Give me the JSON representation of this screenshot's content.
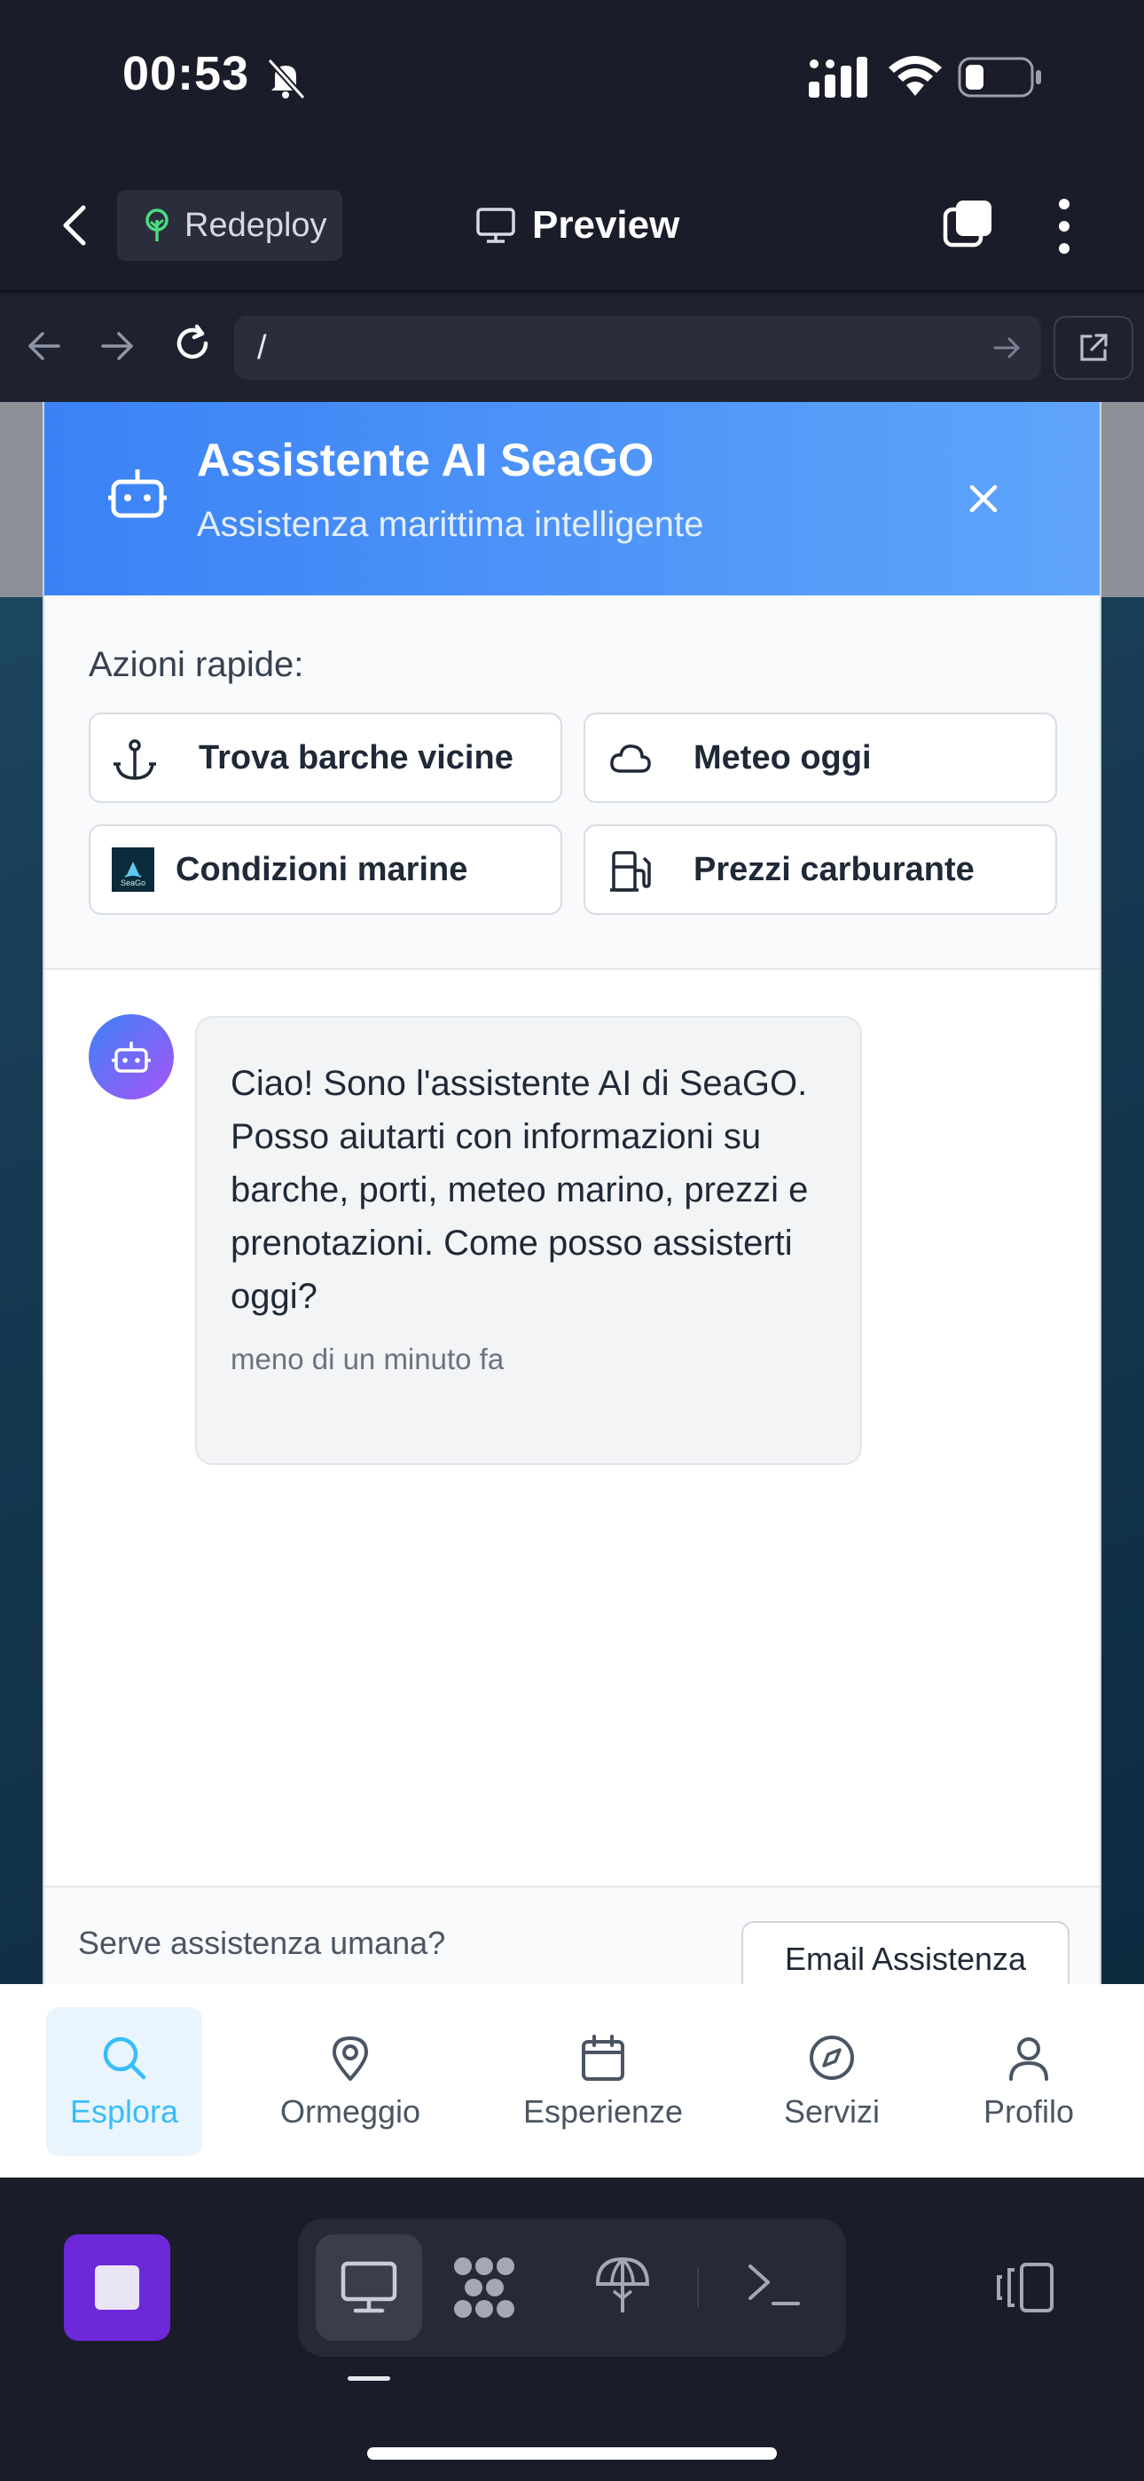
{
  "status_bar": {
    "time": "00:53"
  },
  "app_header": {
    "redeploy_label": "Redeploy",
    "preview_label": "Preview"
  },
  "browser": {
    "url": "/"
  },
  "chat": {
    "title": "Assistente AI SeaGO",
    "subtitle": "Assistenza marittima intelligente",
    "quick_actions_label": "Azioni rapide:",
    "quick_actions": [
      {
        "label": "Trova barche vicine",
        "icon": "anchor-icon"
      },
      {
        "label": "Meteo oggi",
        "icon": "cloud-icon"
      },
      {
        "label": "Condizioni marine",
        "icon": "seago-logo",
        "logo_text": "SeaGo"
      },
      {
        "label": "Prezzi carburante",
        "icon": "fuel-icon"
      }
    ],
    "messages": [
      {
        "sender": "bot",
        "text": "Ciao! Sono l'assistente AI di SeaGO. Posso aiutarti con informazioni su barche, porti, meteo marino, prezzi e prenotazioni. Come posso assisterti oggi?",
        "time": "meno di un minuto fa"
      }
    ],
    "footer_text": "Serve assistenza umana?",
    "email_button": "Email Assistenza"
  },
  "bottom_nav": {
    "items": [
      {
        "label": "Esplora",
        "icon": "search-icon",
        "active": true
      },
      {
        "label": "Ormeggio",
        "icon": "map-pin-icon",
        "active": false
      },
      {
        "label": "Esperienze",
        "icon": "calendar-icon",
        "active": false
      },
      {
        "label": "Servizi",
        "icon": "compass-icon",
        "active": false
      },
      {
        "label": "Profilo",
        "icon": "user-icon",
        "active": false
      }
    ]
  },
  "colors": {
    "accent": "#3b82f6",
    "active_nav": "#38bdf8",
    "stop_button": "#6d28d9",
    "dark_bg": "#1a1d29"
  }
}
